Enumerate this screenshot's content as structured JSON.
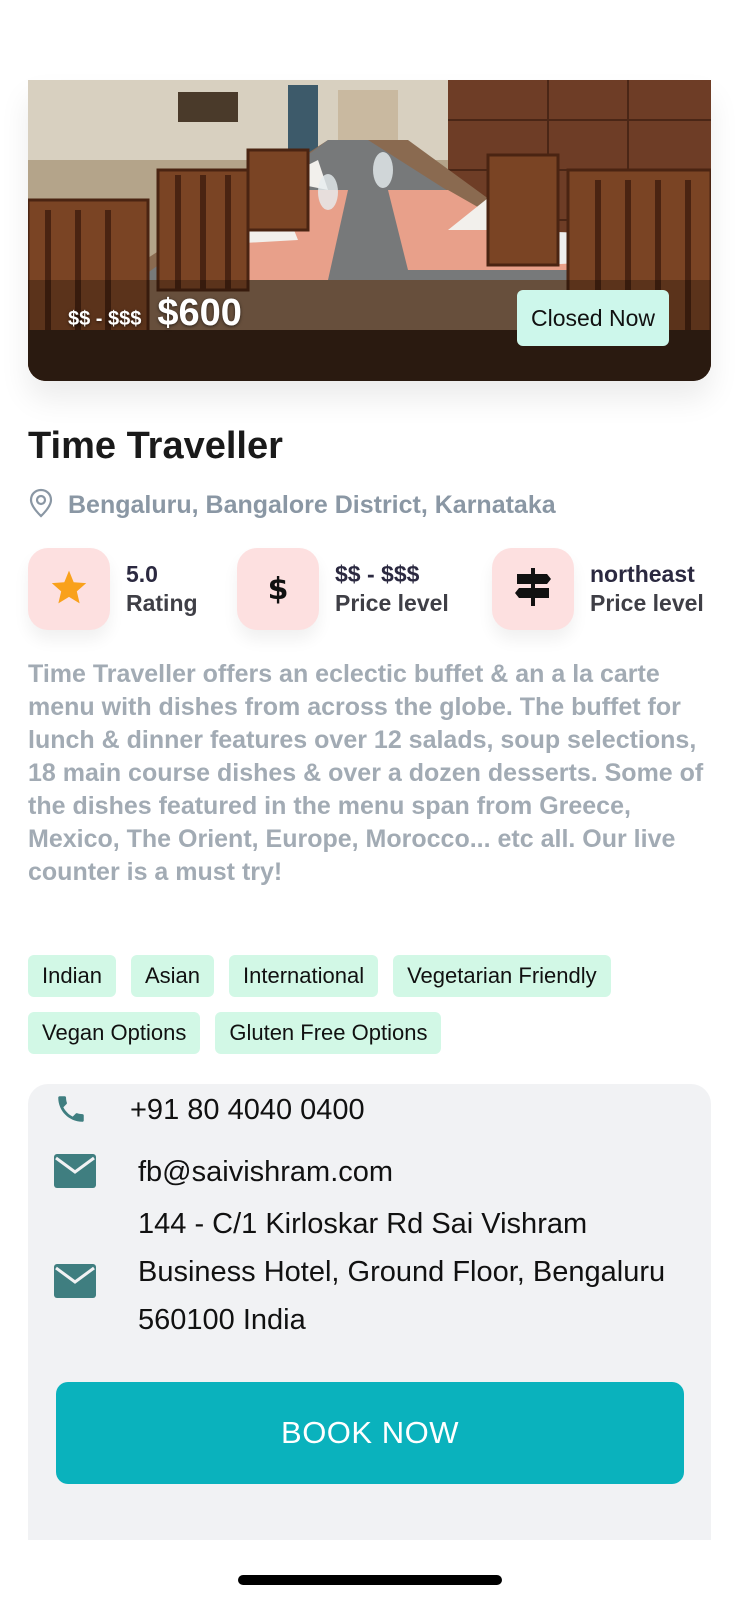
{
  "hero": {
    "price_range": "$$ - $$$",
    "price_amount": "$600",
    "status": "Closed Now"
  },
  "restaurant": {
    "name": "Time Traveller",
    "location": "Bengaluru, Bangalore District, Karnataka",
    "description": "Time Traveller offers an eclectic buffet & an a la carte menu with dishes from across the globe. The buffet for lunch & dinner features over 12 salads, soup selections, 18 main course dishes & over a dozen desserts. Some of the dishes featured in the menu span from Greece, Mexico, The Orient, Europe, Morocco... etc all. Our live counter is a must try!"
  },
  "stats": [
    {
      "value": "5.0",
      "label": "Rating",
      "icon": "star-icon"
    },
    {
      "value": "$$ - $$$",
      "label": "Price level",
      "icon": "dollar-icon"
    },
    {
      "value": "northeast",
      "label": "Price level",
      "icon": "signpost-icon"
    }
  ],
  "tags": [
    "Indian",
    "Asian",
    "International",
    "Vegetarian Friendly",
    "Vegan Options",
    "Gluten Free Options"
  ],
  "contact": {
    "phone": "+91 80 4040 0400",
    "email": "fb@saivishram.com",
    "address_line1": "144 - C/1 Kirloskar Rd Sai Vishram",
    "address_line2": "Business Hotel, Ground Floor, Bengaluru",
    "address_line3": "560100 India"
  },
  "cta": {
    "label": "BOOK NOW"
  },
  "colors": {
    "accent": "#0ab2bd",
    "chip_green": "#d2f8e6",
    "badge_pink": "#fde0e0",
    "icon_teal": "#3f7e80",
    "star": "#f9a11b"
  }
}
